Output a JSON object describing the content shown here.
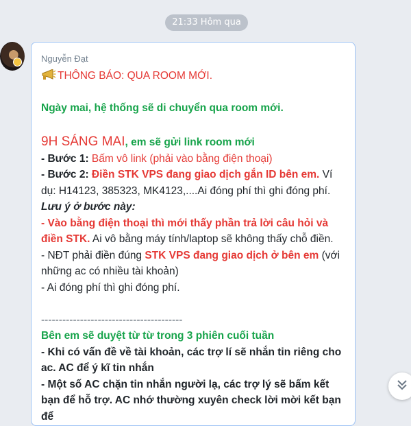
{
  "timestamp": "21:33 Hôm qua",
  "sender": "Nguyễn Đạt",
  "message": {
    "title": "THÔNG BÁO: QUA ROOM MỚI.",
    "intro": "Ngày mai, hệ thống sẽ di chuyển qua room mới.",
    "time_highlight": "9H SÁNG MAI",
    "time_rest": ", em sẽ gửi link room mới",
    "step1_label": "- Bước 1: ",
    "step1_text": "Bấm vô link (phải vào bằng điện thoại)",
    "step2_label": "- Bước 2: ",
    "step2_text": "Điền STK VPS đang giao dịch gắn ID bên em.",
    "step2_example": " Ví dụ: H14123, 385323, MK4123,....Ai đóng phí thì ghi đóng phí.",
    "note_heading": "Lưu ý ở bước này:",
    "note1_a": "- Vào bằng điện thoại",
    "note1_b": " thì mới thấy phần trả lời câu hỏi và điền STK.",
    "note1_c": " Ai vô bằng máy tính/laptop sẽ không thấy chỗ điền.",
    "note2_a": "- NĐT phải điền đúng ",
    "note2_b": "STK VPS đang giao dịch ở bên em",
    "note2_c": " (với những ac có nhiều tài khoản)",
    "note3": "- Ai đóng phí thì ghi đóng phí.",
    "divider": "----------------------------------------",
    "review_heading": "Bên em sẽ duyệt từ từ trong 3 phiên cuối tuần",
    "point1": "- Khi có vấn đề về tài khoản, các trợ lí sẽ nhắn tin riêng cho ac. AC để ý kĩ tin nhắn",
    "point2": "- Một số AC chặn tin nhắn người lạ, các trợ lý sẽ bấm kết bạn để hỗ trợ. AC nhớ thường xuyên check lời mời kết bạn để"
  }
}
